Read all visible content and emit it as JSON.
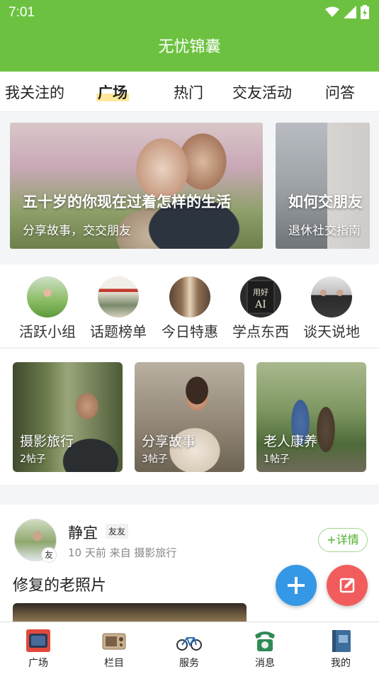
{
  "status": {
    "time": "7:01"
  },
  "app": {
    "title": "无忧锦囊"
  },
  "tabs": [
    {
      "label": "我关注的"
    },
    {
      "label": "广场",
      "active": true
    },
    {
      "label": "热门"
    },
    {
      "label": "交友活动"
    },
    {
      "label": "问答"
    }
  ],
  "banners": [
    {
      "title": "五十岁的你现在过着怎样的生活",
      "subtitle": "分享故事，交交朋友"
    },
    {
      "title": "如何交朋友",
      "subtitle": "退休社交指南"
    }
  ],
  "quick_links": [
    {
      "label": "活跃小组",
      "icon": "group-photo-icon"
    },
    {
      "label": "话题榜单",
      "icon": "newspaper-icon"
    },
    {
      "label": "今日特惠",
      "icon": "shop-icon"
    },
    {
      "label": "学点东西",
      "icon": "book-ai-icon"
    },
    {
      "label": "谈天说地",
      "icon": "chat-people-icon"
    }
  ],
  "topics": [
    {
      "name": "摄影旅行",
      "count": "2帖子"
    },
    {
      "name": "分享故事",
      "count": "3帖子"
    },
    {
      "name": "老人康养",
      "count": "1帖子"
    }
  ],
  "post": {
    "username": "静宜",
    "user_badge": "友友",
    "avatar_badge": "友",
    "meta": "10 天前  来自 摄影旅行",
    "detail_button": "+详情",
    "title": "修复的老照片"
  },
  "fab": {
    "add": "plus-icon",
    "edit": "edit-icon"
  },
  "colors": {
    "brand_green": "#6cc240",
    "fab_blue": "#3498e6",
    "fab_red": "#f25c5c",
    "highlight": "#fde89a"
  },
  "bottom_nav": [
    {
      "label": "广场",
      "icon": "tv-icon"
    },
    {
      "label": "栏目",
      "icon": "radio-icon"
    },
    {
      "label": "服务",
      "icon": "bicycle-icon"
    },
    {
      "label": "消息",
      "icon": "telephone-icon"
    },
    {
      "label": "我的",
      "icon": "book-icon"
    }
  ]
}
